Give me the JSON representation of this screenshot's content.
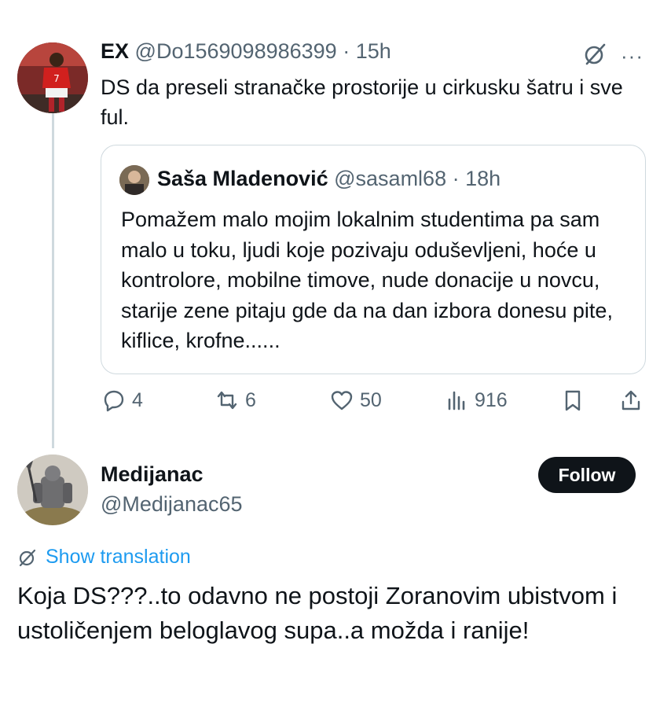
{
  "tweet": {
    "author_name": "EX",
    "handle": "@Do1569098986399",
    "separator": "·",
    "time": "15h",
    "more_label": "···",
    "text": "DS da preseli stranačke prostorije u cirkusku šatru i sve ful.",
    "quote": {
      "author_name": "Saša Mladenović",
      "handle": "@sasaml68",
      "separator": "·",
      "time": "18h",
      "text": "Pomažem malo mojim lokalnim studentima pa sam malo u toku, ljudi koje pozivaju oduševljeni, hoće u kontrolore, mobilne timove, nude donacije u novcu, starije zene pitaju gde da na dan izbora donesu pite, kiflice, krofne......"
    },
    "actions": {
      "replies": "4",
      "reposts": "6",
      "likes": "50",
      "views": "916"
    }
  },
  "reply": {
    "author_name": "Medijanac",
    "handle": "@Medijanac65",
    "follow_label": "Follow",
    "translate_label": "Show translation",
    "text": "Koja DS???..to odavno ne postoji Zoranovim ubistvom i ustoličenjem beloglavog supa..a možda i ranije!"
  },
  "colors": {
    "text": "#0f1419",
    "secondary": "#536471",
    "link": "#1d9bf0",
    "border": "#cfd9de"
  },
  "icons": [
    "grok-icon",
    "more-icon",
    "reply-icon",
    "repost-icon",
    "like-icon",
    "views-icon",
    "bookmark-icon",
    "share-icon",
    "translate-icon"
  ]
}
